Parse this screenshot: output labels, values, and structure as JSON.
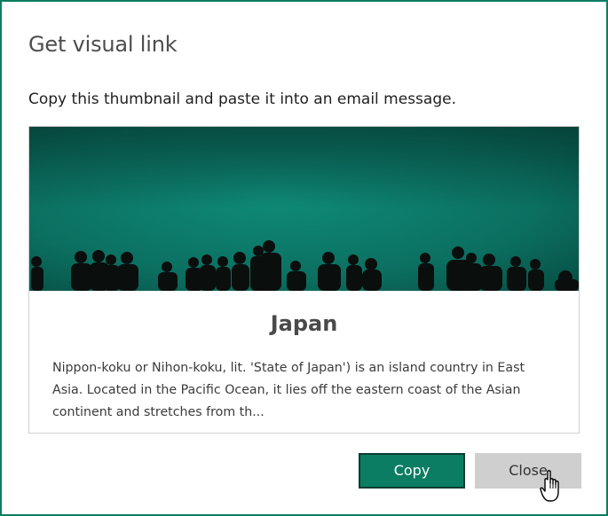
{
  "dialog": {
    "title": "Get visual link",
    "instruction": "Copy this thumbnail and paste it into an email message."
  },
  "card": {
    "title": "Japan",
    "description": "Nippon-koku or Nihon-koku, lit. 'State of Japan') is an island country in East Asia. Located in the Pacific Ocean, it lies off the eastern coast of the Asian continent and stretches from th..."
  },
  "buttons": {
    "copy_label": "Copy",
    "close_label": "Close"
  },
  "colors": {
    "accent": "#0b7d63",
    "thumbnail_teal": "#0f7c6c",
    "button_secondary": "#cfcfcf"
  }
}
